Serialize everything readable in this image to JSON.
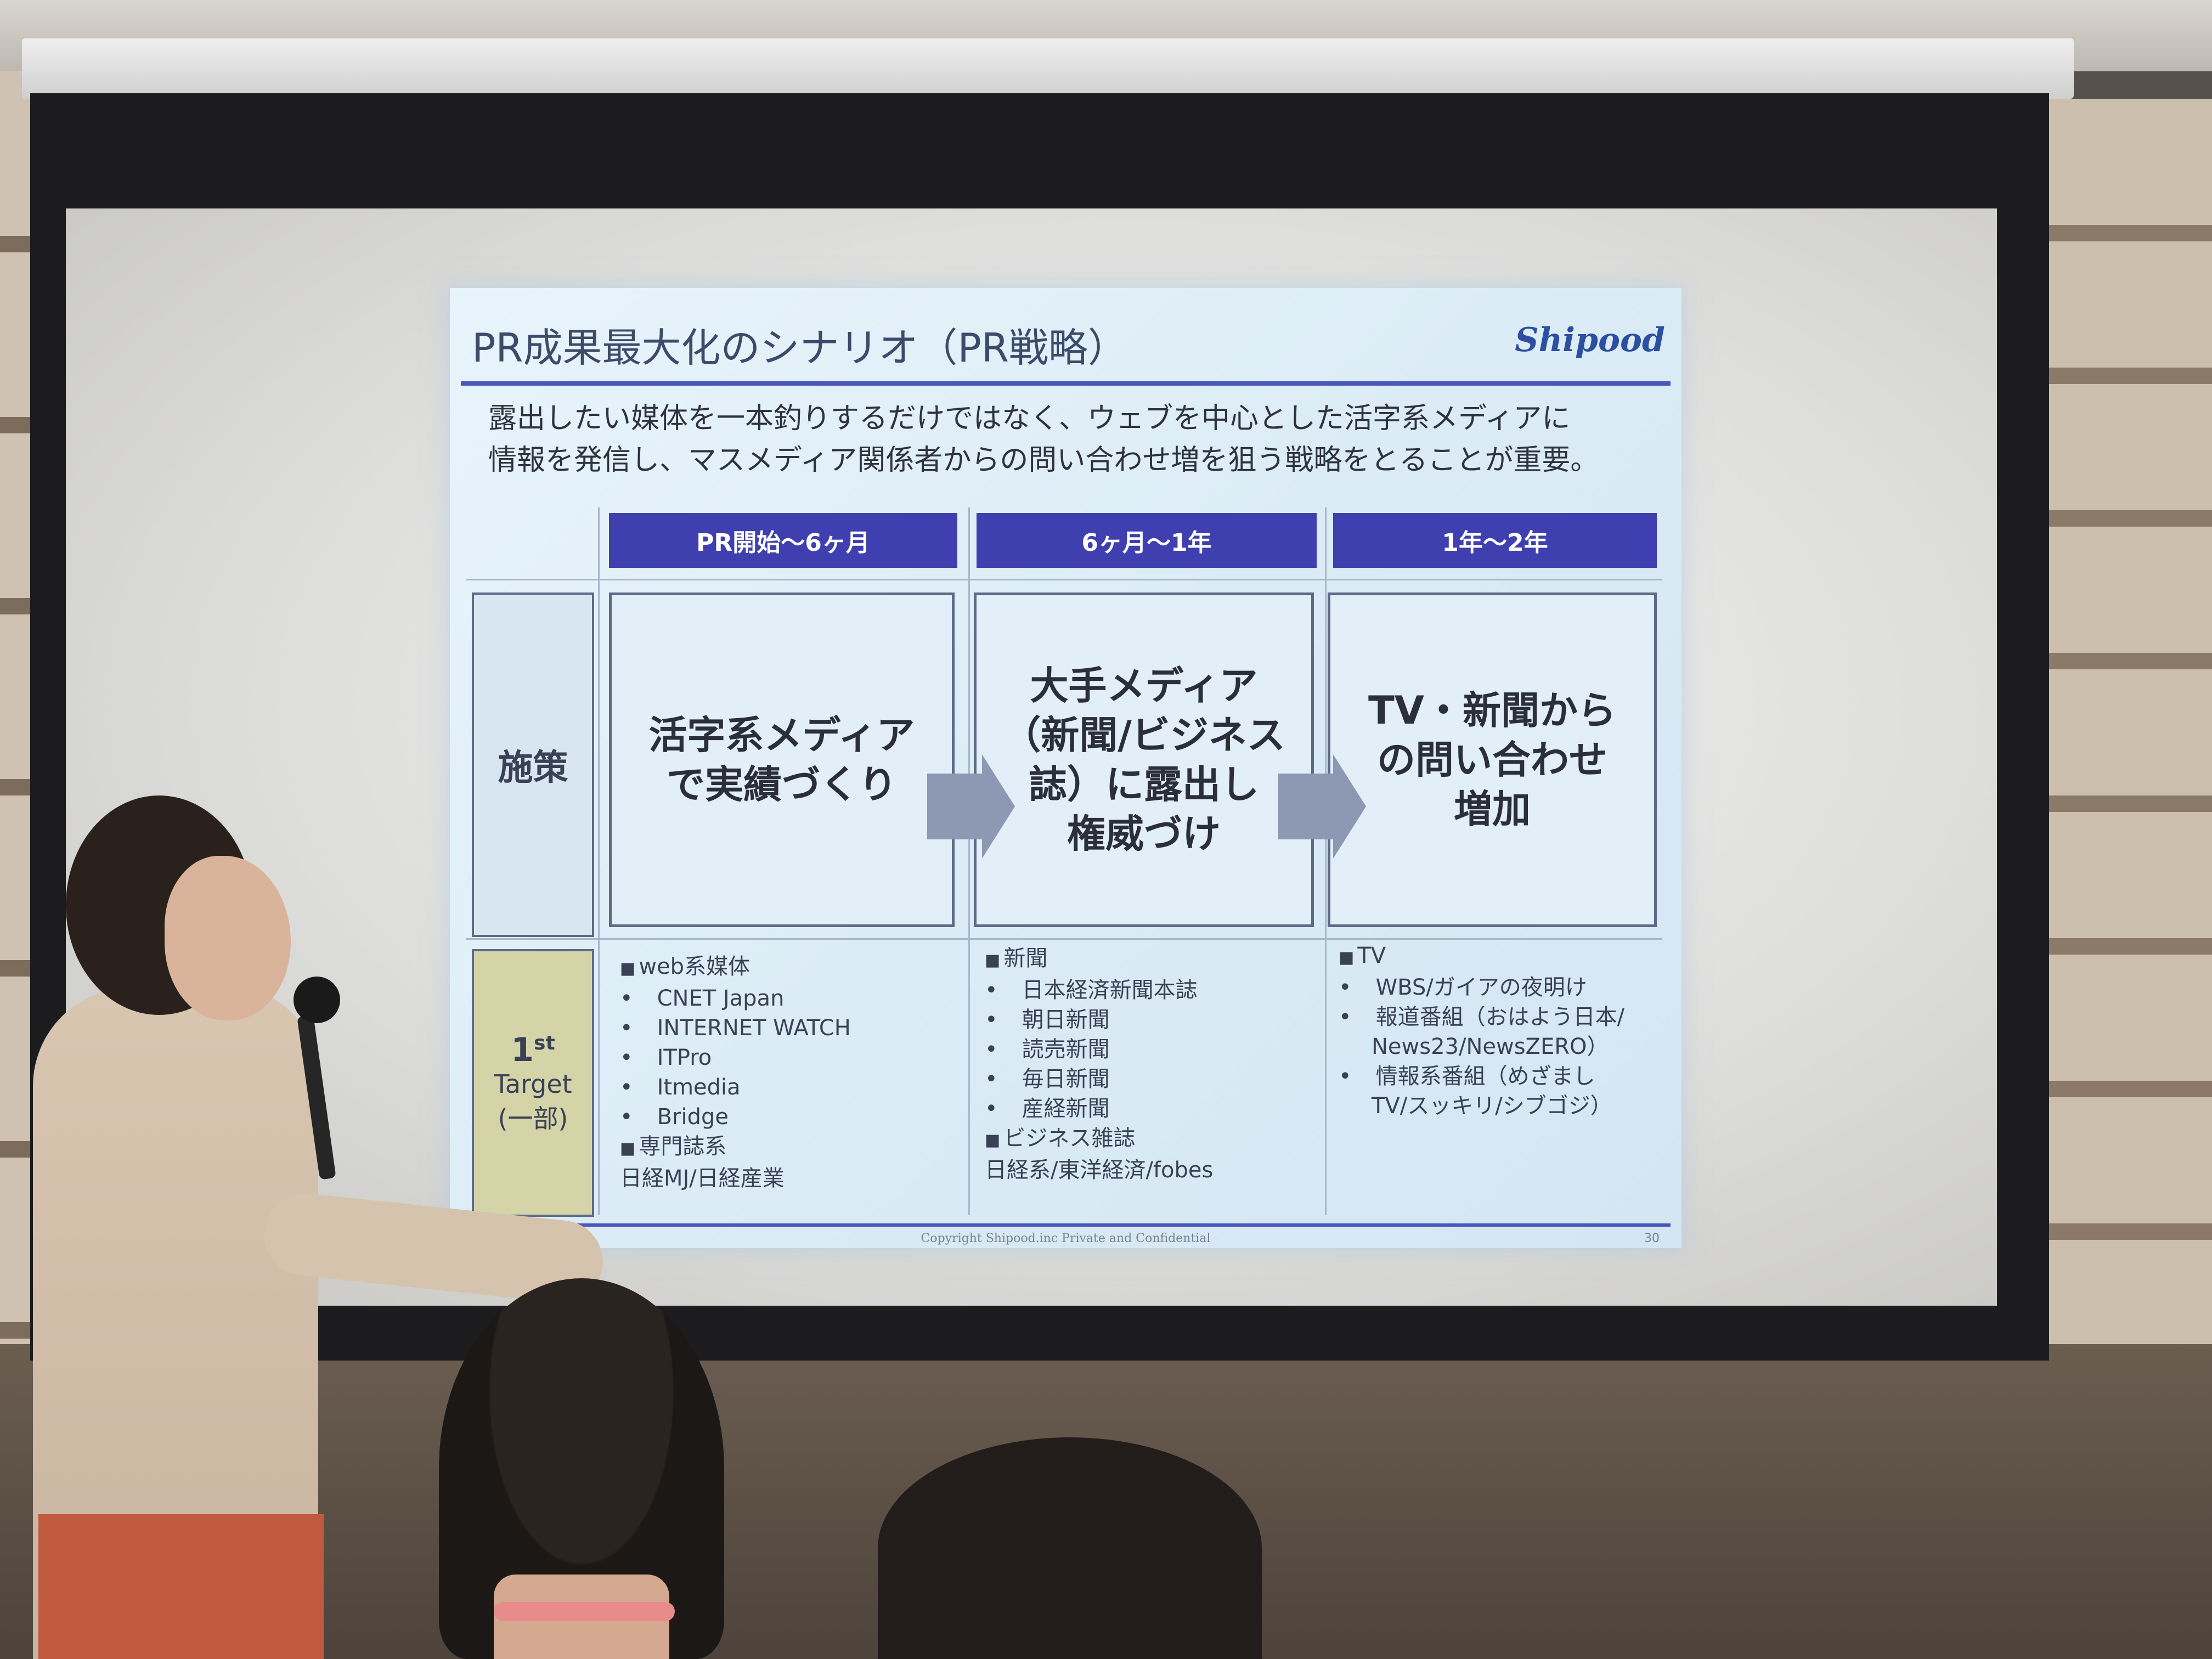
{
  "slide": {
    "title": "PR成果最大化のシナリオ（PR戦略）",
    "logo": "Shipood",
    "intro_line1": "露出したい媒体を一本釣りするだけではなく、ウェブを中心とした活字系メディアに",
    "intro_line2": "情報を発信し、マスメディア関係者からの問い合わせ増を狙う戦略をとることが重要。",
    "columns": [
      "PR開始～6ヶ月",
      "6ヶ月～1年",
      "1年～2年"
    ],
    "row_measure_label": "施策",
    "row_target_label_main": "1",
    "row_target_label_sup": "st",
    "row_target_label_sub1": "Target",
    "row_target_label_sub2": "(一部)",
    "measures": [
      [
        "活字系メディア",
        "で実績づくり"
      ],
      [
        "大手メディア",
        "（新聞/ビジネス",
        "誌）に露出し",
        "権威づけ"
      ],
      [
        "TV・新聞から",
        "の問い合わせ",
        "増加"
      ]
    ],
    "targets": {
      "col1": {
        "head1": "web系媒体",
        "items1": [
          "CNET Japan",
          "INTERNET WATCH",
          "ITPro",
          "Itmedia",
          "Bridge"
        ],
        "head2": "専門誌系",
        "plain2": "日経MJ/日経産業"
      },
      "col2": {
        "head1": "新聞",
        "items1": [
          "日本経済新聞本誌",
          "朝日新聞",
          "読売新聞",
          "毎日新聞",
          "産経新聞"
        ],
        "head2": "ビジネス雑誌",
        "plain2": "日経系/東洋経済/fobes"
      },
      "col3": {
        "head1": "TV",
        "items": [
          "WBS/ガイアの夜明け",
          "報道番組（おはよう日本/",
          "情報系番組（めざまし"
        ],
        "cont": [
          "News23/NewsZERO）",
          "TV/スッキリ/シブゴジ）"
        ]
      }
    },
    "copyright": "Copyright Shipood.inc Private and Confidential",
    "page_number": "30"
  },
  "colors": {
    "header_band": "#3f3fb0",
    "rule": "#4a57b8",
    "target_label_bg": "#d5d4a8",
    "arrow": "#8d98b3"
  }
}
